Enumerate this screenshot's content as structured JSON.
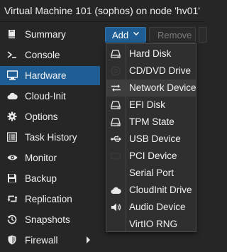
{
  "window": {
    "title": "Virtual Machine 101 (sophos) on node 'hv01'"
  },
  "sidebar": {
    "items": [
      {
        "label": "Summary",
        "icon": "book-icon"
      },
      {
        "label": "Console",
        "icon": "terminal-icon"
      },
      {
        "label": "Hardware",
        "icon": "desktop-icon",
        "selected": true
      },
      {
        "label": "Cloud-Init",
        "icon": "cloud-icon"
      },
      {
        "label": "Options",
        "icon": "gear-icon"
      },
      {
        "label": "Task History",
        "icon": "list-icon"
      },
      {
        "label": "Monitor",
        "icon": "eye-icon"
      },
      {
        "label": "Backup",
        "icon": "floppy-icon"
      },
      {
        "label": "Replication",
        "icon": "retweet-icon"
      },
      {
        "label": "Snapshots",
        "icon": "history-icon"
      },
      {
        "label": "Firewall",
        "icon": "shield-icon",
        "has_submenu": true
      }
    ]
  },
  "toolbar": {
    "add_label": "Add",
    "remove_label": "Remove"
  },
  "add_menu": {
    "items": [
      {
        "label": "Hard Disk",
        "icon": "hdd-icon"
      },
      {
        "label": "CD/DVD Drive",
        "icon": "cdrom-icon"
      },
      {
        "label": "Network Device",
        "icon": "exchange-icon",
        "hovered": true
      },
      {
        "label": "EFI Disk",
        "icon": "hdd-icon"
      },
      {
        "label": "TPM State",
        "icon": "hdd-icon"
      },
      {
        "label": "USB Device",
        "icon": "usb-icon"
      },
      {
        "label": "PCI Device",
        "icon": "pci-card-icon"
      },
      {
        "label": "Serial Port",
        "icon": "none"
      },
      {
        "label": "CloudInit Drive",
        "icon": "cloud-icon"
      },
      {
        "label": "Audio Device",
        "icon": "volume-icon"
      },
      {
        "label": "VirtIO RNG",
        "icon": "none"
      }
    ]
  },
  "colors": {
    "background": "#262626",
    "selected": "#1f5e94",
    "menu_background": "#2f2f2f",
    "menu_hover": "#3d3d3d",
    "text": "#f2f2f2"
  }
}
